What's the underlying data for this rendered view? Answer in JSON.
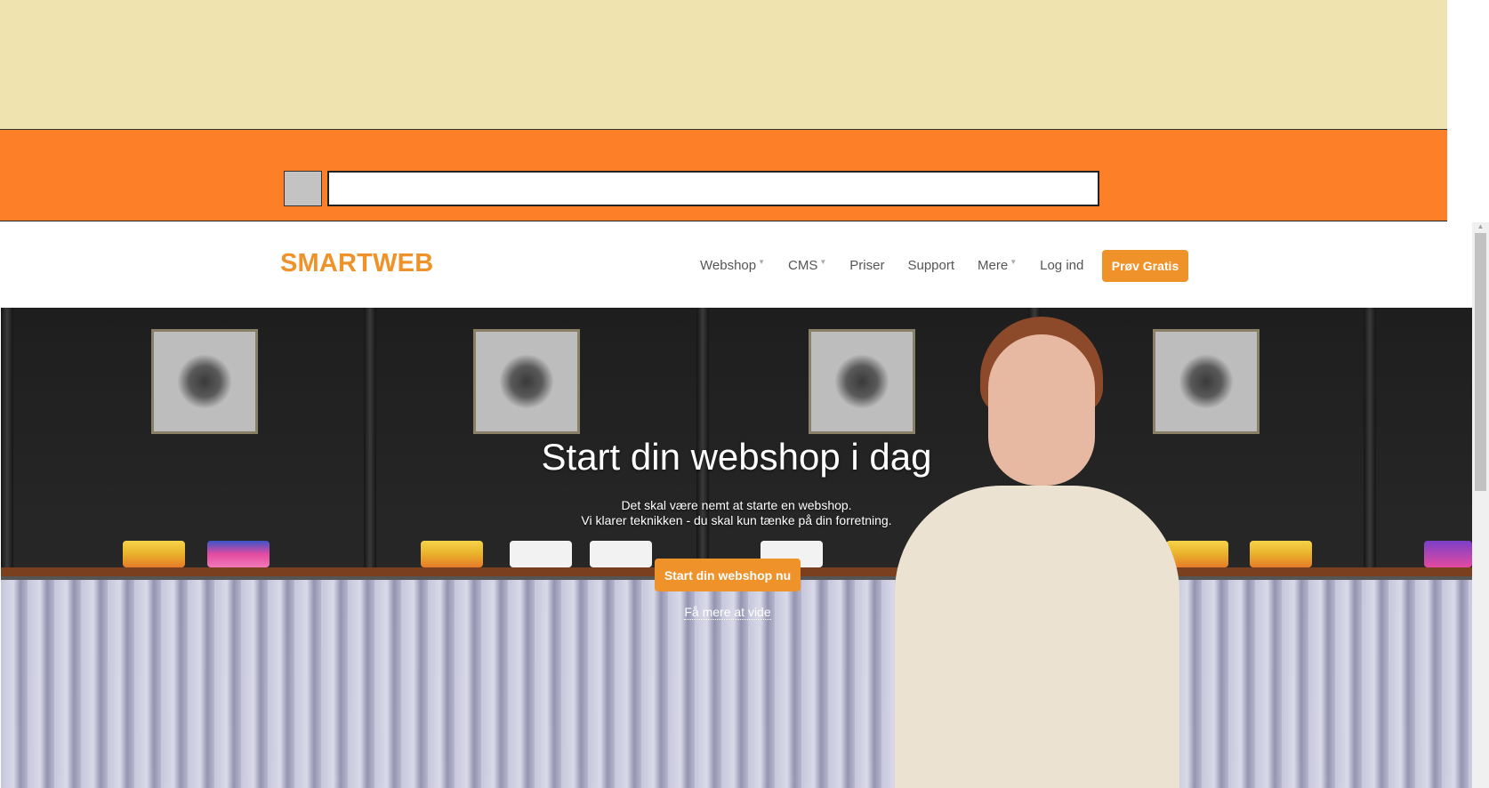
{
  "search": {
    "value": "",
    "placeholder": ""
  },
  "header": {
    "logo": "SMARTWEB",
    "nav": [
      {
        "label": "Webshop",
        "dropdown": true
      },
      {
        "label": "CMS",
        "dropdown": true
      },
      {
        "label": "Priser",
        "dropdown": false
      },
      {
        "label": "Support",
        "dropdown": false
      },
      {
        "label": "Mere",
        "dropdown": true
      },
      {
        "label": "Log ind",
        "dropdown": false
      }
    ],
    "cta": "Prøv Gratis"
  },
  "hero": {
    "title": "Start din webshop i dag",
    "subtitle_line1": "Det skal være nemt at starte en webshop.",
    "subtitle_line2": "Vi klarer teknikken - du skal kun tænke på din forretning.",
    "cta": "Start din webshop nu",
    "link": "Få mere at vide"
  },
  "colors": {
    "toolbar_bg": "#efe4b0",
    "orange_bar": "#fd7f28",
    "brand_orange": "#f0922a",
    "nav_text": "#555555"
  },
  "icons": {
    "caret": "chevron-down-icon",
    "scroll_up": "scroll-up-arrow-icon"
  }
}
